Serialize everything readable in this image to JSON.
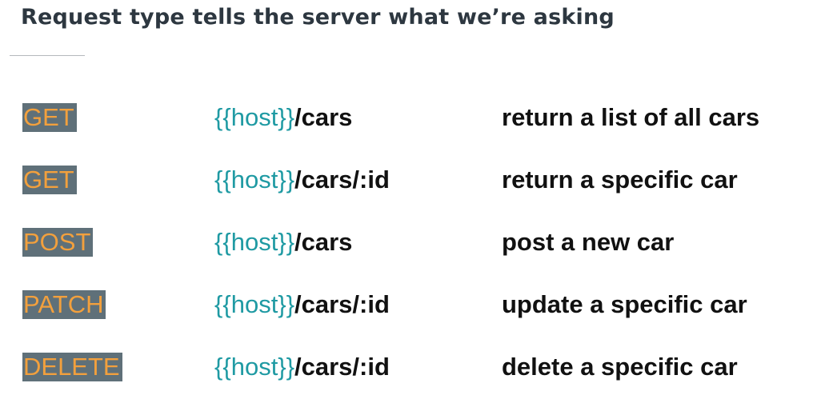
{
  "slide": {
    "title": "Request type tells the server what we’re asking",
    "rows": [
      {
        "method": "GET",
        "host_var": "{{host}}",
        "path": "/cars",
        "description": "return a list of all cars"
      },
      {
        "method": "GET",
        "host_var": "{{host}}",
        "path": "/cars/:id",
        "description": "return a specific car"
      },
      {
        "method": "POST",
        "host_var": "{{host}}",
        "path": "/cars",
        "description": "post a new car"
      },
      {
        "method": "PATCH",
        "host_var": "{{host}}",
        "path": "/cars/:id",
        "description": "update a specific car"
      },
      {
        "method": "DELETE",
        "host_var": "{{host}}",
        "path": "/cars/:id",
        "description": "delete a specific car"
      }
    ],
    "colors": {
      "method_bg": "#5f7079",
      "method_text": "#f2a03d",
      "host_var": "#1f9aa3",
      "text": "#111111",
      "title": "#2d3740"
    }
  }
}
